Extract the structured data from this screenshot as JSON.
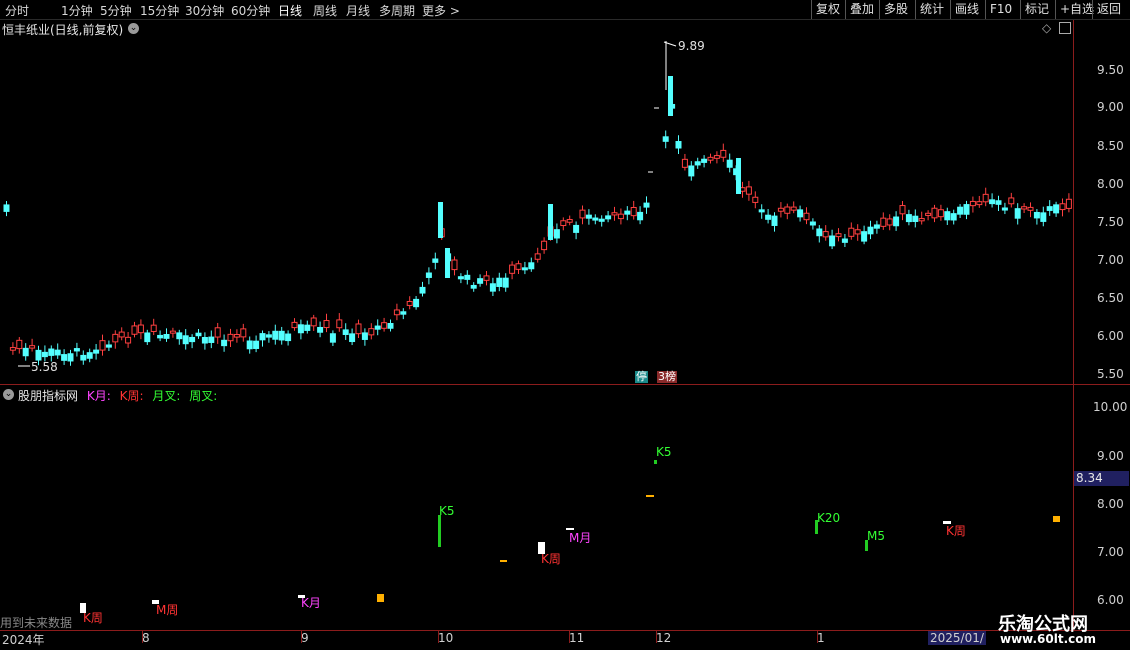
{
  "toolbar": {
    "periods": [
      "分时",
      "1分钟",
      "5分钟",
      "15分钟",
      "30分钟",
      "60分钟",
      "日线",
      "周线",
      "月线",
      "多周期",
      "更多"
    ],
    "active_period": "日线",
    "right_buttons": [
      "复权",
      "叠加",
      "多股",
      "统计",
      "画线",
      "F10",
      "标记",
      "+自选",
      "返回"
    ]
  },
  "main_chart": {
    "title": "恒丰纸业(日线,前复权)",
    "y_ticks": [
      "9.50",
      "9.00",
      "8.50",
      "8.00",
      "7.50",
      "7.00",
      "6.50",
      "6.00",
      "5.50"
    ],
    "high_label": "9.89",
    "low_label": "5.58",
    "badge_stop": "停",
    "badge_rank": "榜",
    "badge_rank_num": "3",
    "diamond_icon": "diamond-icon"
  },
  "indicator": {
    "name": "股朋指标网",
    "legend": [
      {
        "text": "K月:",
        "color": "#ff44ff"
      },
      {
        "text": "K周:",
        "color": "#ff3333"
      },
      {
        "text": "月叉:",
        "color": "#33ff33"
      },
      {
        "text": "周叉:",
        "color": "#33ff33"
      }
    ],
    "y_ticks": [
      "10.00",
      "9.00",
      "8.00",
      "7.00"
    ],
    "y_tick_partial": "6.00",
    "current_value": "8.34",
    "labels": [
      {
        "text": "K周",
        "color": "#ff3333"
      },
      {
        "text": "M周",
        "color": "#ff3333"
      },
      {
        "text": "K月",
        "color": "#ff44ff"
      },
      {
        "text": "K5",
        "color": "#33ff33"
      },
      {
        "text": "K周",
        "color": "#ff3333"
      },
      {
        "text": "M月",
        "color": "#ff44ff"
      },
      {
        "text": "K5",
        "color": "#33ff33"
      },
      {
        "text": "K20",
        "color": "#33ff33"
      },
      {
        "text": "M5",
        "color": "#33ff33"
      },
      {
        "text": "K周",
        "color": "#ff3333"
      }
    ]
  },
  "bottom": {
    "note": "用到未来数据",
    "dates": [
      "2024年",
      "8",
      "9",
      "10",
      "11",
      "12",
      "1",
      "2025/01/"
    ]
  },
  "watermark": {
    "line1": "乐淘公式网",
    "line2": "www.60lt.com"
  },
  "colors": {
    "up": "#ff4040",
    "down": "#54ffff",
    "grid": "#8b1c1c",
    "marker_orange": "#ffb000"
  }
}
